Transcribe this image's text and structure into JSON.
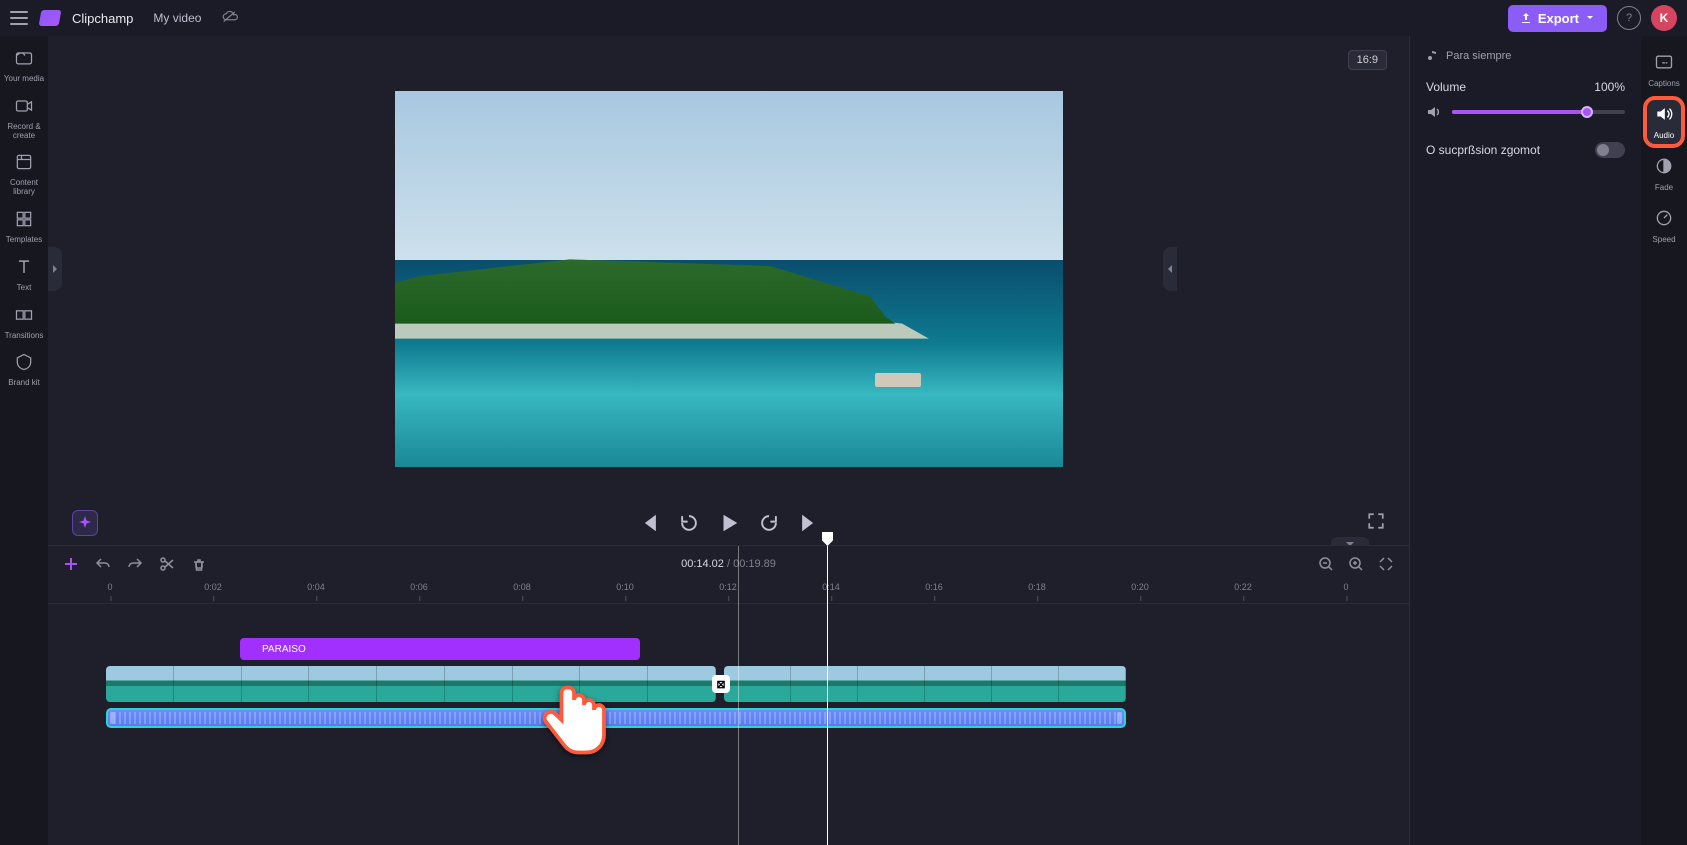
{
  "topbar": {
    "brand": "Clipchamp",
    "project": "My video",
    "export": "Export",
    "avatar_letter": "K"
  },
  "left_sidebar": {
    "items": [
      {
        "label": "Your media",
        "name": "your-media"
      },
      {
        "label": "Record & create",
        "name": "record-create"
      },
      {
        "label": "Content library",
        "name": "content-library"
      },
      {
        "label": "Templates",
        "name": "templates"
      },
      {
        "label": "Text",
        "name": "text"
      },
      {
        "label": "Transitions",
        "name": "transitions"
      },
      {
        "label": "Brand kit",
        "name": "brand-kit"
      }
    ]
  },
  "right_sidebar": {
    "items": [
      {
        "label": "Captions",
        "name": "captions"
      },
      {
        "label": "Audio",
        "name": "audio",
        "active": true,
        "highlight": true
      },
      {
        "label": "Fade",
        "name": "fade"
      },
      {
        "label": "Speed",
        "name": "speed"
      }
    ]
  },
  "preview": {
    "aspect": "16:9"
  },
  "audio_panel": {
    "clip_name": "Para siempre",
    "volume_label": "Volume",
    "volume_value": "100%",
    "noise_label": "O sucprßsion zgomot"
  },
  "timeline": {
    "current": "00:14.02",
    "duration": "00:19.89",
    "ruler": [
      "0",
      "0:02",
      "0:04",
      "0:06",
      "0:08",
      "0:10",
      "0:12",
      "0:14",
      "0:16",
      "0:18",
      "0:20",
      "0:22",
      "0"
    ],
    "text_clip_label": "PARAISO"
  }
}
